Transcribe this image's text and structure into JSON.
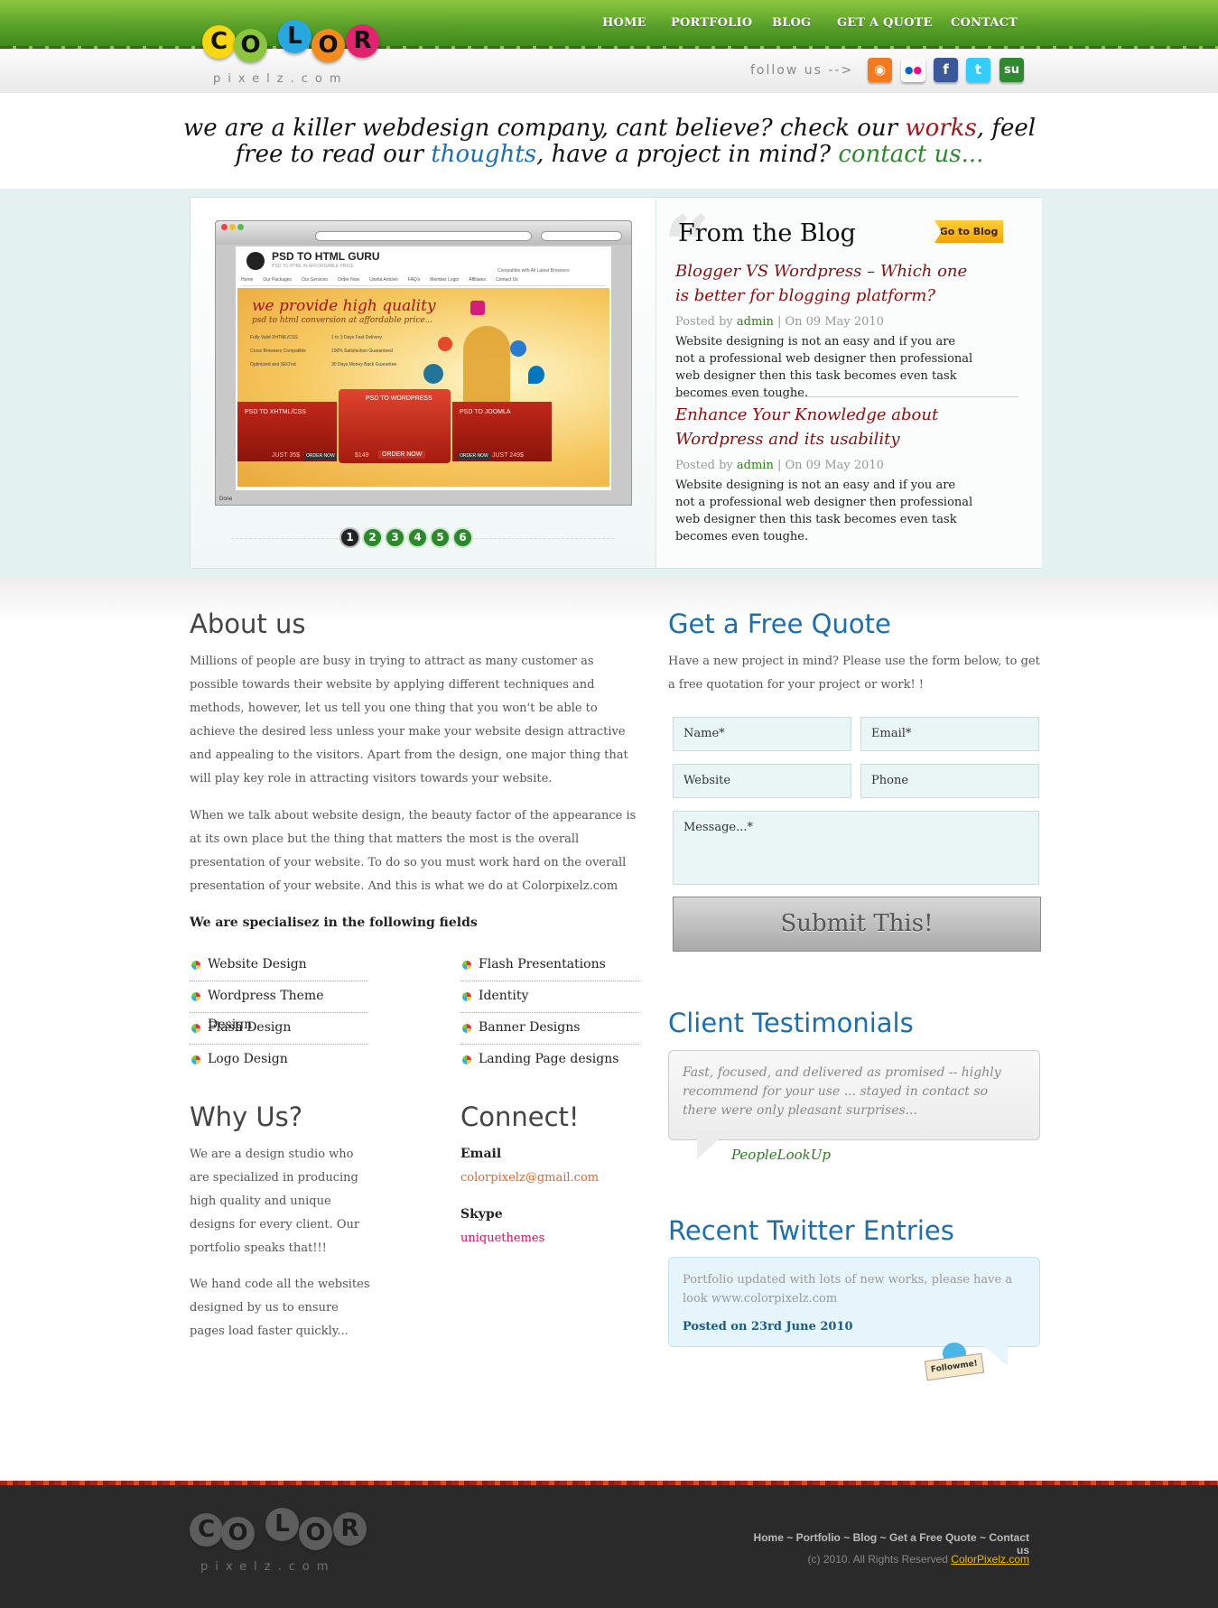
{
  "logo": {
    "letters": [
      "C",
      "O",
      "L",
      "O",
      "R"
    ],
    "sub": "pixelz.com"
  },
  "nav": [
    "HOME",
    "PORTFOLIO",
    "BLOG",
    "GET A QUOTE",
    "CONTACT"
  ],
  "follow": "follow us -->",
  "social_icons": [
    "rss-icon",
    "flickr-icon",
    "facebook-icon",
    "twitter-icon",
    "stumbleupon-icon"
  ],
  "tagline": {
    "p1": "we are a killer webdesign company, cant believe? check our ",
    "works": "works",
    "p2": ", feel",
    "p3": "free to read our ",
    "thoughts": "thoughts",
    "p4": ", have a project in mind? ",
    "contact": "contact us..."
  },
  "slider": {
    "screen": {
      "site_name": "PSD TO HTML GURU",
      "site_sub": "PSD TO HTML IN AFFORDABLE PRICE",
      "compat": "Compatible with All Latest Browsers",
      "menu": [
        "Home",
        "Our Packages",
        "Our Services",
        "Order Now",
        "Useful Articles",
        "FAQ's",
        "Member Login",
        "Affiliates",
        "Contact Us"
      ],
      "headline": "we provide high quality",
      "subline": "psd to html conversion at affordable price...",
      "checks": [
        "Fully Valid XHTML/CSS",
        "1 to 3 Days Fast Delivery",
        "Cross Browsers Compatible",
        "100% Satisfaction Guaranteed",
        "Optimized and SEO'ed",
        "30 Days Money Back Guarantee"
      ],
      "boxes": [
        {
          "title": "PSD TO XHTML/CSS",
          "price": "JUST 35$",
          "btn": "ORDER NOW"
        },
        {
          "title": "PSD TO WORDPRESS",
          "price": "$149",
          "btn": "ORDER NOW"
        },
        {
          "title": "PSD TO JOOMLA",
          "price": "JUST 249$",
          "btn": "ORDER NOW"
        }
      ],
      "status": "Done"
    },
    "pages": [
      "1",
      "2",
      "3",
      "4",
      "5",
      "6"
    ]
  },
  "blog": {
    "heading": "From the Blog",
    "go_label": "Go to Blog",
    "posts": [
      {
        "title": "Blogger VS Wordpress – Which one is better for blogging platform?",
        "posted_by": "Posted by",
        "author": "admin",
        "on": "| On 09 May 2010",
        "excerpt": "Website designing is not an easy and if you are not a professional web designer then professional web designer then this task becomes even task becomes even toughe."
      },
      {
        "title": "Enhance Your Knowledge about Wordpress and its usability",
        "posted_by": "Posted by",
        "author": "admin",
        "on": "| On 09 May 2010",
        "excerpt": "Website designing is not an easy and if you are not a professional web designer then professional web designer then this task becomes even task becomes even toughe."
      }
    ]
  },
  "about": {
    "heading": "About us",
    "p1": "Millions of people are busy in trying to attract as many customer as possible towards their website by applying different techniques and methods, however, let us tell you one thing that you won't be able to achieve the desired less unless your make your website design attractive and appealing to the visitors. Apart from the design, one major thing that will play key role in attracting visitors towards your website.",
    "p2": "When we talk about website design, the beauty factor of the appearance is at its own place but the thing that matters the most is the overall presentation of your website. To do so you must work hard on the overall presentation of your website. And this is what we do at Colorpixelz.com",
    "fields_heading": "We are specialisez in the following fields",
    "fields_left": [
      "Website Design",
      "Wordpress Theme Design",
      "Flash Design",
      "Logo Design"
    ],
    "fields_right": [
      "Flash Presentations",
      "Identity",
      "Banner Designs",
      "Landing Page designs"
    ]
  },
  "why": {
    "heading": "Why Us?",
    "p1": "We are a design studio who are specialized in producing high quality and unique designs for every client. Our portfolio speaks that!!!",
    "p2": "We hand code all the websites designed by us to ensure pages load faster quickly..."
  },
  "connect": {
    "heading": "Connect!",
    "email_label": "Email",
    "email": "colorpixelz@gmail.com",
    "skype_label": "Skype",
    "skype": "uniquethemes"
  },
  "quote": {
    "heading": "Get a Free Quote",
    "intro": "Have a new project in mind? Please use the form below, to get a free quotation for your project or work! !",
    "name_ph": "Name*",
    "email_ph": "Email*",
    "website_ph": "Website",
    "phone_ph": "Phone",
    "message_ph": "Message...*",
    "submit": "Submit This!"
  },
  "testimonials": {
    "heading": "Client Testimonials",
    "quote": "Fast, focused, and delivered as promised -- highly recommend for your use ... stayed in contact so there were only pleasant surprises...",
    "author": "PeopleLookUp"
  },
  "twitter": {
    "heading": "Recent Twitter Entries",
    "text": "Portfolio updated with lots of new works, please have a look www.colorpixelz.com",
    "posted": "Posted on 23rd June 2010",
    "follow_badge": "Followme!"
  },
  "footer": {
    "links": [
      "Home",
      "Portfolio",
      "Blog",
      "Get a Free Quote",
      "Contact us"
    ],
    "sep": " ~ ",
    "copyright": "(c) 2010. All Rights Reserved ",
    "brand": "ColorPixelz.com"
  },
  "colors": {
    "green": "#5aa229",
    "blue": "#1a6fb4",
    "red": "#8c0d0d",
    "orange": "#e8641e",
    "pink": "#d0125e"
  }
}
